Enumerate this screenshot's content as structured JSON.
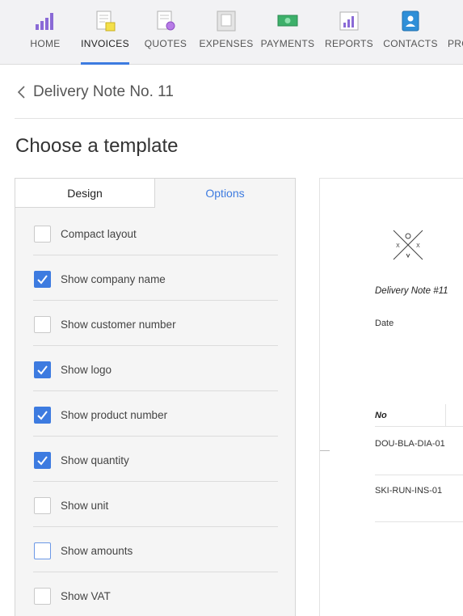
{
  "nav": {
    "items": [
      {
        "label": "HOME",
        "icon": "home-bars-icon",
        "active": false
      },
      {
        "label": "INVOICES",
        "icon": "invoices-icon",
        "active": true
      },
      {
        "label": "QUOTES",
        "icon": "quotes-icon",
        "active": false
      },
      {
        "label": "EXPENSES",
        "icon": "expenses-icon",
        "active": false
      },
      {
        "label": "PAYMENTS",
        "icon": "payments-icon",
        "active": false
      },
      {
        "label": "REPORTS",
        "icon": "reports-icon",
        "active": false
      },
      {
        "label": "CONTACTS",
        "icon": "contacts-icon",
        "active": false
      },
      {
        "label": "PRO",
        "icon": "products-icon",
        "active": false
      }
    ]
  },
  "header": {
    "back_title": "Delivery Note No. 11",
    "heading": "Choose a template"
  },
  "tabs": {
    "design": "Design",
    "options": "Options",
    "active": "options"
  },
  "options": [
    {
      "label": "Compact layout",
      "checked": false
    },
    {
      "label": "Show company name",
      "checked": true
    },
    {
      "label": "Show customer number",
      "checked": false
    },
    {
      "label": "Show logo",
      "checked": true
    },
    {
      "label": "Show product number",
      "checked": true
    },
    {
      "label": "Show quantity",
      "checked": true
    },
    {
      "label": "Show unit",
      "checked": false
    },
    {
      "label": "Show amounts",
      "checked": false
    },
    {
      "label": "Show VAT",
      "checked": false
    }
  ],
  "preview": {
    "title": "Delivery Note #11",
    "date_label": "Date",
    "column_no": "No",
    "rows": [
      "DOU-BLA-DIA-01",
      "SKI-RUN-INS-01"
    ]
  },
  "colors": {
    "accent": "#3d7be0",
    "nav_bg": "#f2f2f4",
    "panel_bg": "#f5f5f5"
  }
}
